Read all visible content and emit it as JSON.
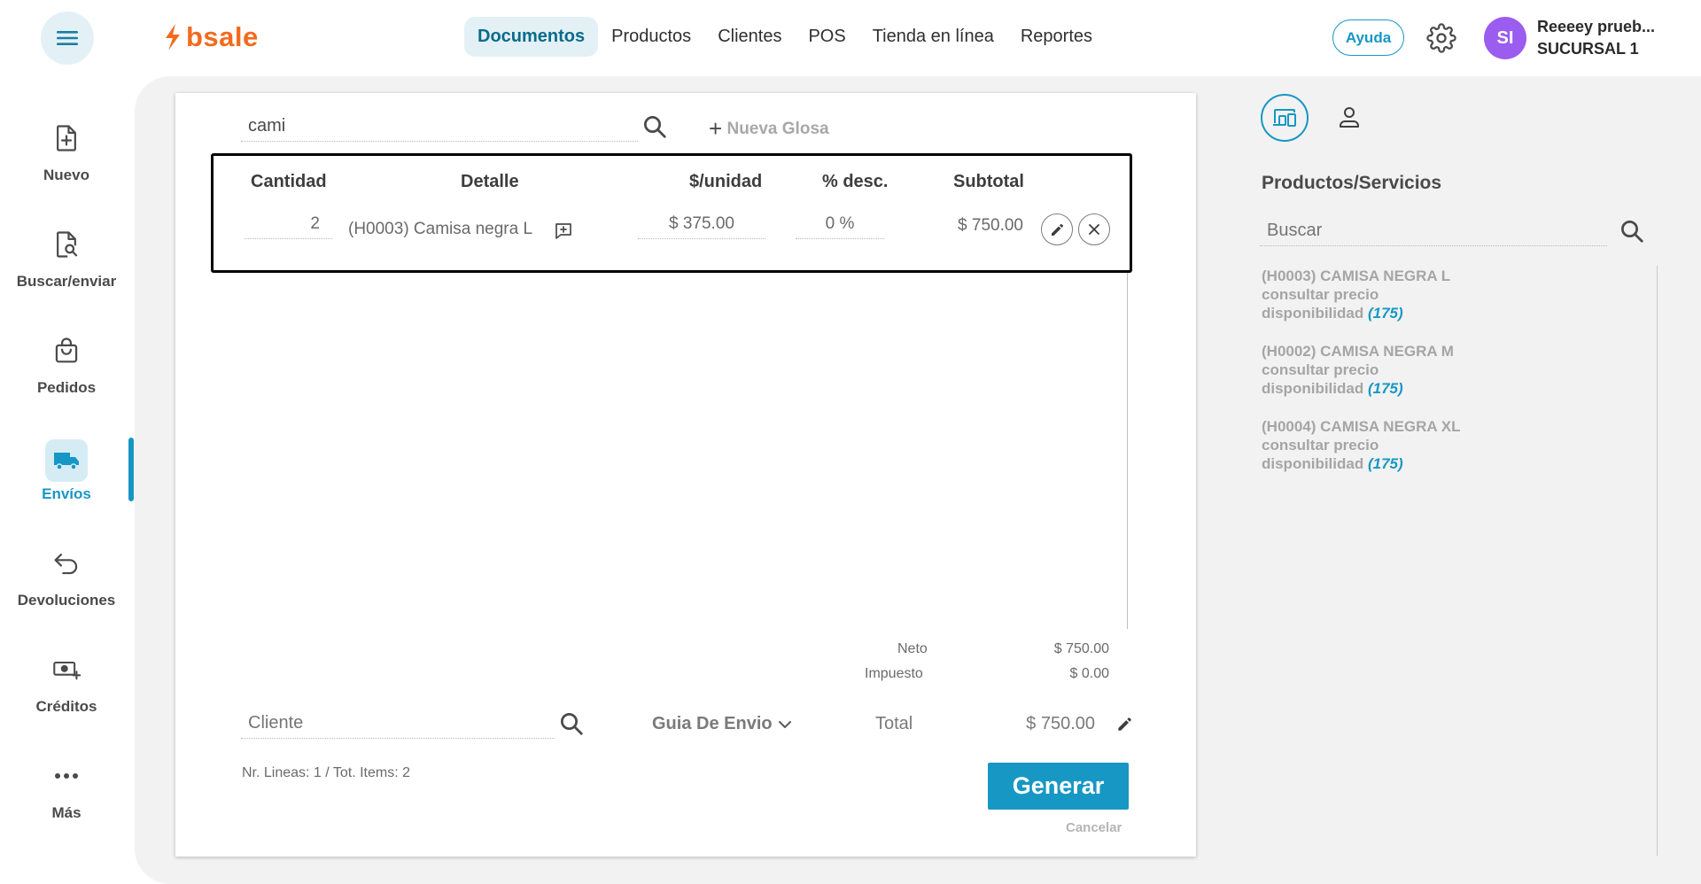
{
  "header": {
    "logo_text": "bsale",
    "nav": [
      {
        "label": "Documentos",
        "active": true
      },
      {
        "label": "Productos",
        "active": false
      },
      {
        "label": "Clientes",
        "active": false
      },
      {
        "label": "POS",
        "active": false
      },
      {
        "label": "Tienda en línea",
        "active": false
      },
      {
        "label": "Reportes",
        "active": false
      }
    ],
    "help_label": "Ayuda",
    "avatar_initials": "SI",
    "user_name": "Reeeey prueb...",
    "branch": "SUCURSAL 1"
  },
  "sidebar": {
    "items": [
      {
        "label": "Nuevo",
        "icon": "file-plus-icon"
      },
      {
        "label": "Buscar/enviar",
        "icon": "file-search-icon"
      },
      {
        "label": "Pedidos",
        "icon": "shopping-bag-icon"
      },
      {
        "label": "Envíos",
        "icon": "truck-icon",
        "active": true
      },
      {
        "label": "Devoluciones",
        "icon": "return-arrow-icon"
      },
      {
        "label": "Créditos",
        "icon": "money-plus-icon"
      },
      {
        "label": "Más",
        "icon": "more-dots-icon"
      }
    ]
  },
  "document": {
    "search_value": "cami",
    "new_glosa_label": "Nueva Glosa",
    "columns": {
      "quantity": "Cantidad",
      "detail": "Detalle",
      "unit_price": "$/unidad",
      "discount": "% desc.",
      "subtotal": "Subtotal"
    },
    "lines": [
      {
        "quantity": "2",
        "detail": "(H0003) Camisa negra L",
        "unit_price": "$ 375.00",
        "discount": "0 %",
        "subtotal": "$ 750.00"
      }
    ],
    "totals": {
      "net_label": "Neto",
      "net_value": "$ 750.00",
      "tax_label": "Impuesto",
      "tax_value": "$ 0.00",
      "total_label": "Total",
      "total_value": "$ 750.00"
    },
    "client_placeholder": "Cliente",
    "doc_type": "Guia De Envio",
    "lines_info": "Nr. Lineas: 1 / Tot. Items: 2",
    "generate_label": "Generar",
    "cancel_label": "Cancelar"
  },
  "panel": {
    "title": "Productos/Servicios",
    "search_placeholder": "Buscar",
    "products": [
      {
        "name": "(H0003) CAMISA NEGRA L",
        "price": "consultar precio",
        "availability_label": "disponibilidad",
        "stock": "(175)"
      },
      {
        "name": "(H0002) CAMISA NEGRA M",
        "price": "consultar precio",
        "availability_label": "disponibilidad",
        "stock": "(175)"
      },
      {
        "name": "(H0004) CAMISA NEGRA XL",
        "price": "consultar precio",
        "availability_label": "disponibilidad",
        "stock": "(175)"
      }
    ]
  },
  "colors": {
    "accent": "#1797c4",
    "brand": "#f26b1d",
    "avatar": "#9b5cf0"
  }
}
